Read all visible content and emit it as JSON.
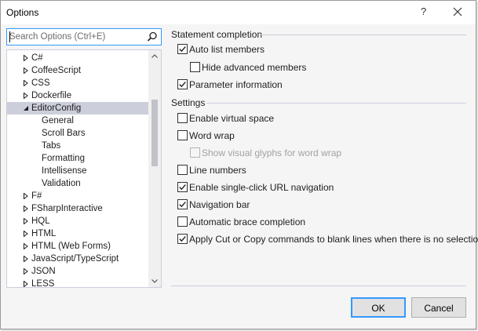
{
  "window": {
    "title": "Options",
    "help_label": "?"
  },
  "search": {
    "placeholder": "Search Options (Ctrl+E)"
  },
  "tree": {
    "items": [
      {
        "label": "C#",
        "kind": "collapsed"
      },
      {
        "label": "CoffeeScript",
        "kind": "collapsed"
      },
      {
        "label": "CSS",
        "kind": "collapsed"
      },
      {
        "label": "Dockerfile",
        "kind": "collapsed"
      },
      {
        "label": "EditorConfig",
        "kind": "expanded",
        "selected": true
      },
      {
        "label": "General",
        "kind": "child"
      },
      {
        "label": "Scroll Bars",
        "kind": "child"
      },
      {
        "label": "Tabs",
        "kind": "child"
      },
      {
        "label": "Formatting",
        "kind": "child"
      },
      {
        "label": "Intellisense",
        "kind": "child"
      },
      {
        "label": "Validation",
        "kind": "child"
      },
      {
        "label": "F#",
        "kind": "collapsed"
      },
      {
        "label": "FSharpInteractive",
        "kind": "collapsed"
      },
      {
        "label": "HQL",
        "kind": "collapsed"
      },
      {
        "label": "HTML",
        "kind": "collapsed"
      },
      {
        "label": "HTML (Web Forms)",
        "kind": "collapsed"
      },
      {
        "label": "JavaScript/TypeScript",
        "kind": "collapsed"
      },
      {
        "label": "JSON",
        "kind": "collapsed"
      },
      {
        "label": "LESS",
        "kind": "collapsed"
      }
    ]
  },
  "statement_completion": {
    "header": "Statement completion",
    "options": [
      {
        "label": "Auto list members",
        "checked": true,
        "disabled": false
      },
      {
        "label": "Hide advanced members",
        "checked": false,
        "disabled": false
      },
      {
        "label": "Parameter information",
        "checked": true,
        "disabled": false
      }
    ]
  },
  "settings": {
    "header": "Settings",
    "options": [
      {
        "label": "Enable virtual space",
        "checked": false,
        "disabled": false
      },
      {
        "label": "Word wrap",
        "checked": false,
        "disabled": false
      },
      {
        "label": "Show visual glyphs for word wrap",
        "checked": false,
        "disabled": true
      },
      {
        "label": "Line numbers",
        "checked": false,
        "disabled": false
      },
      {
        "label": "Enable single-click URL navigation",
        "checked": true,
        "disabled": false
      },
      {
        "label": "Navigation bar",
        "checked": true,
        "disabled": false
      },
      {
        "label": "Automatic brace completion",
        "checked": false,
        "disabled": false
      },
      {
        "label": "Apply Cut or Copy commands to blank lines when there is no selection",
        "checked": true,
        "disabled": false
      }
    ]
  },
  "buttons": {
    "ok": "OK",
    "cancel": "Cancel"
  },
  "icons": {
    "search": "search-icon",
    "close": "close-icon",
    "collapsed": "triangle-right-icon",
    "expanded": "triangle-down-icon",
    "check": "checkmark-icon"
  },
  "colors": {
    "accent": "#3399ff",
    "selection": "#cccedb"
  }
}
